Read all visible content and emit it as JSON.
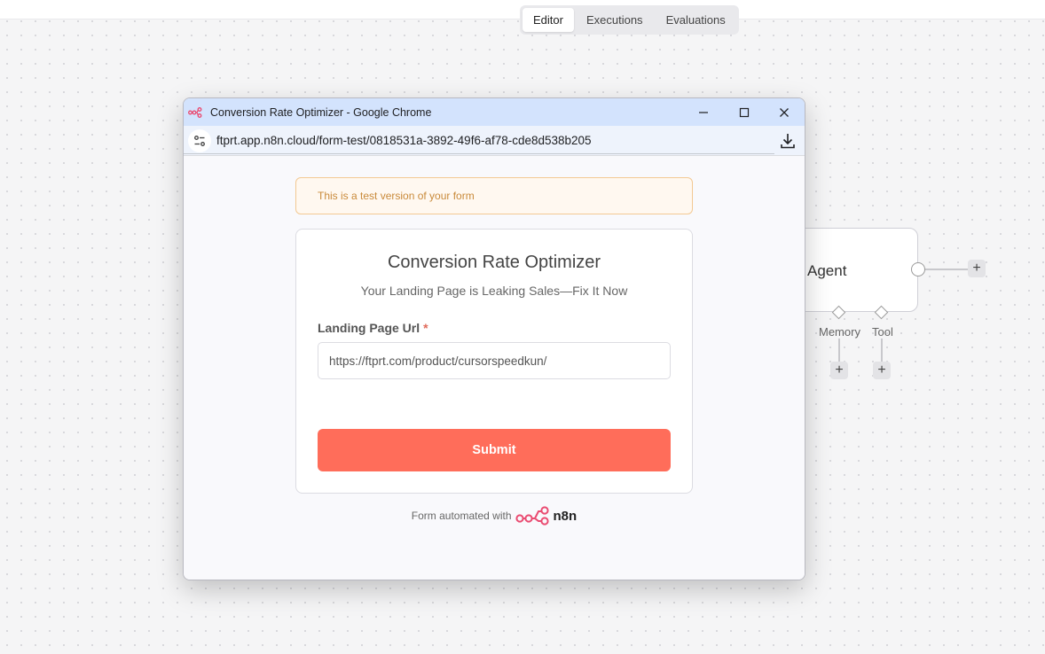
{
  "canvas": {
    "tabs": [
      {
        "label": "Editor",
        "active": true
      },
      {
        "label": "Executions",
        "active": false
      },
      {
        "label": "Evaluations",
        "active": false
      }
    ],
    "agent_node": {
      "label": "Agent"
    },
    "sub_ports": [
      {
        "label": "Memory"
      },
      {
        "label": "Tool"
      }
    ],
    "plus_symbol": "+"
  },
  "browser": {
    "window_title": "Conversion Rate Optimizer - Google Chrome",
    "url": "ftprt.app.n8n.cloud/form-test/0818531a-3892-49f6-af78-cde8d538b205",
    "icons": {
      "favicon": "n8n-favicon-icon",
      "minimize": "minimize-icon",
      "maximize": "maximize-icon",
      "close": "close-icon",
      "site_info": "site-info-icon",
      "download": "download-icon"
    }
  },
  "form": {
    "test_banner": "This is a test version of your form",
    "title": "Conversion Rate Optimizer",
    "subtitle": "Your Landing Page is Leaking Sales—Fix It Now",
    "field_label": "Landing Page Url",
    "required_mark": "*",
    "field_value": "https://ftprt.com/product/cursorspeedkun/",
    "submit_label": "Submit",
    "footer_text": "Form automated with",
    "brand_name": "n8n"
  },
  "colors": {
    "accent": "#ff6d5a",
    "banner_text": "#c98a3a",
    "titlebar": "#d3e3fd",
    "logo_pink": "#ea4b71"
  }
}
